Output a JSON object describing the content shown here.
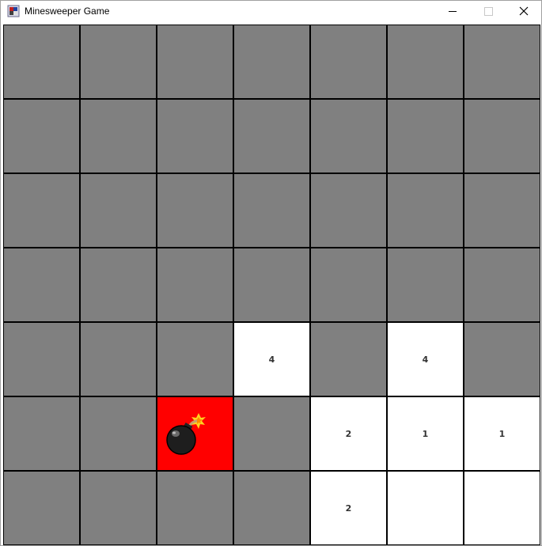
{
  "window": {
    "title": "Minesweeper Game",
    "app_icon": "minesweeper-app-icon",
    "controls": {
      "minimize": "minimize-icon",
      "maximize": "maximize-icon",
      "close": "close-icon"
    }
  },
  "board": {
    "rows": 7,
    "cols": 7,
    "colors": {
      "hidden": "#808080",
      "revealed": "#ffffff",
      "exploded": "#ff0000",
      "grid": "#000000"
    },
    "cells": [
      [
        {
          "s": "hidden",
          "n": ""
        },
        {
          "s": "hidden",
          "n": ""
        },
        {
          "s": "hidden",
          "n": ""
        },
        {
          "s": "hidden",
          "n": ""
        },
        {
          "s": "hidden",
          "n": ""
        },
        {
          "s": "hidden",
          "n": ""
        },
        {
          "s": "hidden",
          "n": ""
        }
      ],
      [
        {
          "s": "hidden",
          "n": ""
        },
        {
          "s": "hidden",
          "n": ""
        },
        {
          "s": "hidden",
          "n": ""
        },
        {
          "s": "hidden",
          "n": ""
        },
        {
          "s": "hidden",
          "n": ""
        },
        {
          "s": "hidden",
          "n": ""
        },
        {
          "s": "hidden",
          "n": ""
        }
      ],
      [
        {
          "s": "hidden",
          "n": ""
        },
        {
          "s": "hidden",
          "n": ""
        },
        {
          "s": "hidden",
          "n": ""
        },
        {
          "s": "hidden",
          "n": ""
        },
        {
          "s": "hidden",
          "n": ""
        },
        {
          "s": "hidden",
          "n": ""
        },
        {
          "s": "hidden",
          "n": ""
        }
      ],
      [
        {
          "s": "hidden",
          "n": ""
        },
        {
          "s": "hidden",
          "n": ""
        },
        {
          "s": "hidden",
          "n": ""
        },
        {
          "s": "hidden",
          "n": ""
        },
        {
          "s": "hidden",
          "n": ""
        },
        {
          "s": "hidden",
          "n": ""
        },
        {
          "s": "hidden",
          "n": ""
        }
      ],
      [
        {
          "s": "hidden",
          "n": ""
        },
        {
          "s": "hidden",
          "n": ""
        },
        {
          "s": "hidden",
          "n": ""
        },
        {
          "s": "revealed",
          "n": "4"
        },
        {
          "s": "hidden",
          "n": ""
        },
        {
          "s": "revealed",
          "n": "4"
        },
        {
          "s": "hidden",
          "n": ""
        }
      ],
      [
        {
          "s": "hidden",
          "n": ""
        },
        {
          "s": "hidden",
          "n": ""
        },
        {
          "s": "exploded",
          "n": "",
          "icon": "bomb-icon"
        },
        {
          "s": "hidden",
          "n": ""
        },
        {
          "s": "revealed",
          "n": "2"
        },
        {
          "s": "revealed",
          "n": "1"
        },
        {
          "s": "revealed",
          "n": "1"
        }
      ],
      [
        {
          "s": "hidden",
          "n": ""
        },
        {
          "s": "hidden",
          "n": ""
        },
        {
          "s": "hidden",
          "n": ""
        },
        {
          "s": "hidden",
          "n": ""
        },
        {
          "s": "revealed",
          "n": "2"
        },
        {
          "s": "revealed",
          "n": ""
        },
        {
          "s": "revealed",
          "n": ""
        }
      ]
    ]
  }
}
